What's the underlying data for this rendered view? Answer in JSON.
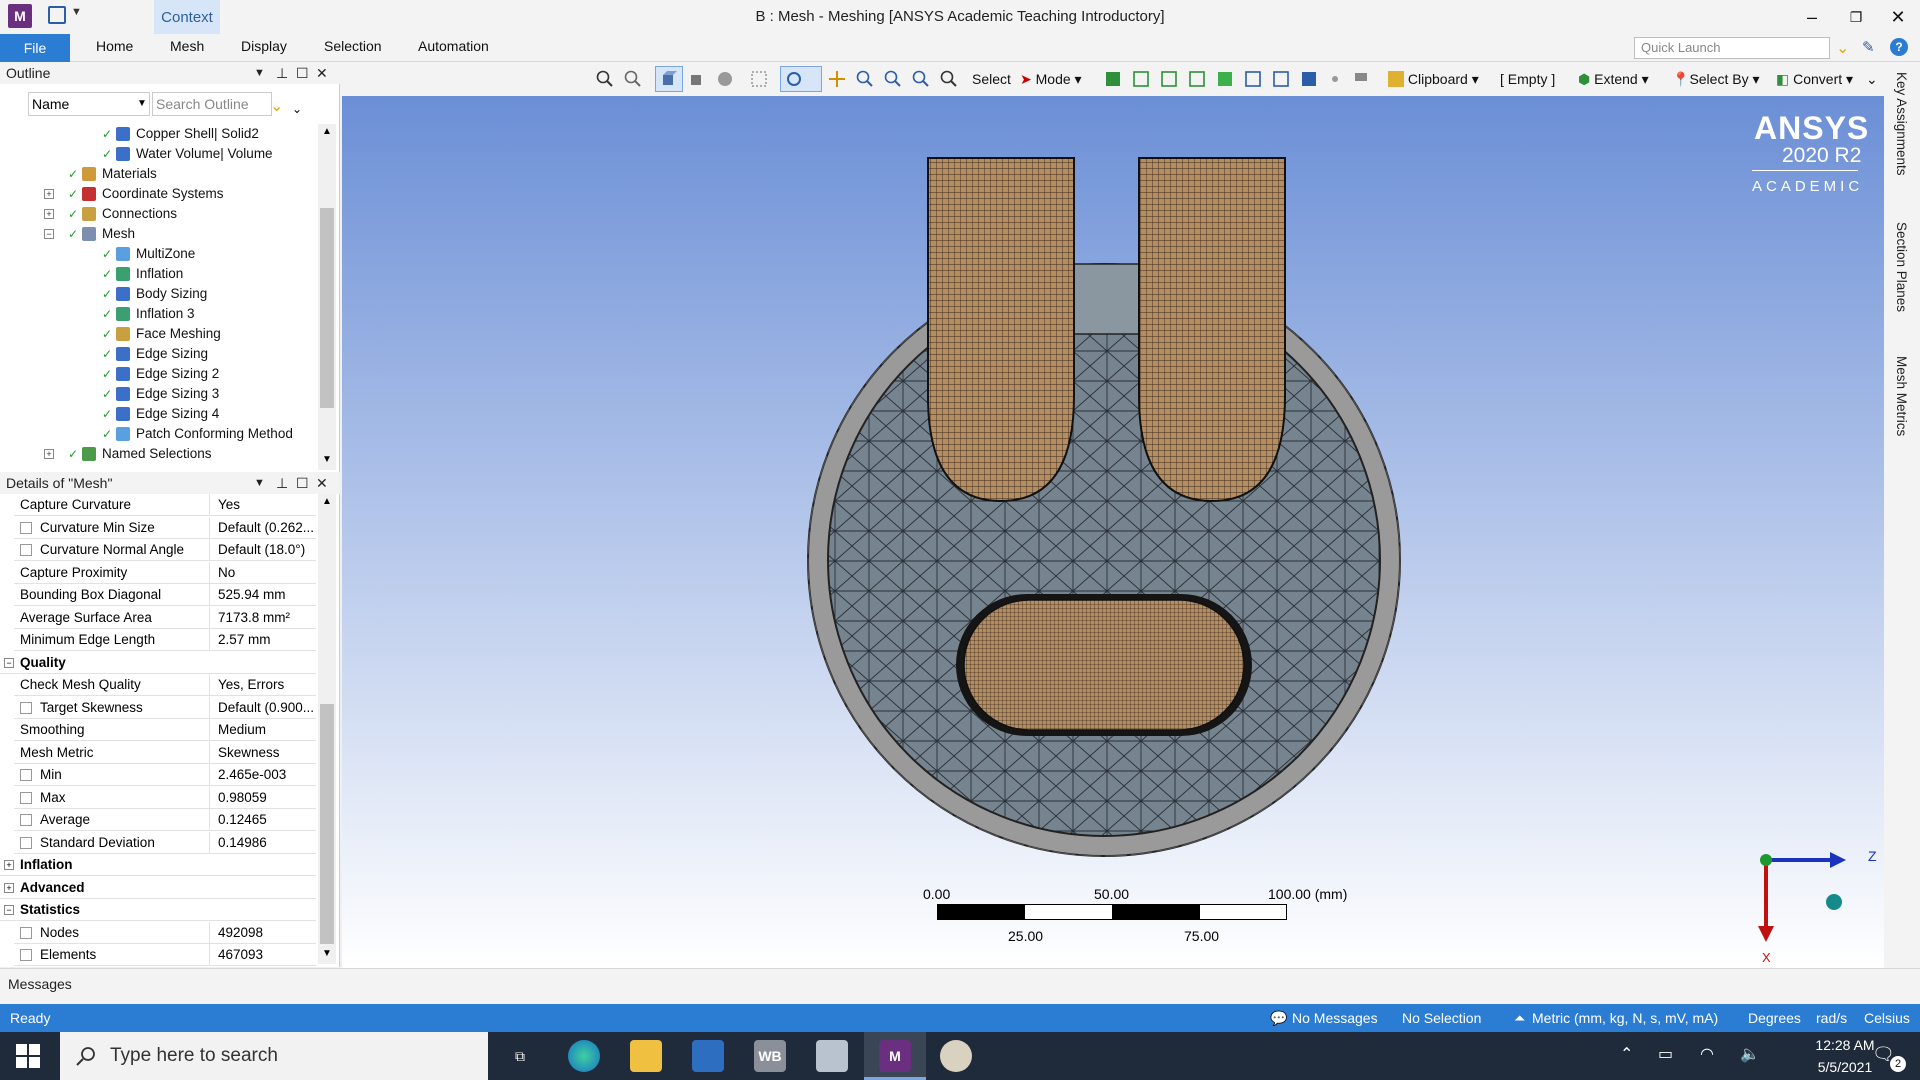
{
  "window": {
    "title": "B : Mesh - Meshing [ANSYS Academic Teaching Introductory]",
    "context_tab": "Context",
    "app_icon": "M"
  },
  "ribbon": {
    "tabs": [
      "File",
      "Home",
      "Mesh",
      "Display",
      "Selection",
      "Automation"
    ],
    "quick_launch_placeholder": "Quick Launch"
  },
  "toolbar": {
    "select_label": "Select",
    "mode_label": "Mode",
    "clipboard_label": "Clipboard",
    "empty_label": "[ Empty ]",
    "extend_label": "Extend",
    "select_by_label": "Select By",
    "convert_label": "Convert"
  },
  "outline": {
    "title": "Outline",
    "filter_value": "Name",
    "search_placeholder": "Search Outline",
    "items": [
      {
        "label": "Copper Shell|  Solid2",
        "icon": "solid-body-icon"
      },
      {
        "label": "Water Volume|  Volume",
        "icon": "solid-body-icon"
      },
      {
        "label": "Materials",
        "icon": "materials-icon"
      },
      {
        "label": "Coordinate Systems",
        "icon": "coordinate-systems-icon"
      },
      {
        "label": "Connections",
        "icon": "connections-icon"
      },
      {
        "label": "Mesh",
        "icon": "mesh-icon"
      },
      {
        "label": "MultiZone",
        "icon": "multizone-icon"
      },
      {
        "label": "Inflation",
        "icon": "inflation-icon"
      },
      {
        "label": "Body Sizing",
        "icon": "sizing-icon"
      },
      {
        "label": "Inflation 3",
        "icon": "inflation-icon"
      },
      {
        "label": "Face Meshing",
        "icon": "face-meshing-icon"
      },
      {
        "label": "Edge Sizing",
        "icon": "sizing-icon"
      },
      {
        "label": "Edge Sizing 2",
        "icon": "sizing-icon"
      },
      {
        "label": "Edge Sizing 3",
        "icon": "sizing-icon"
      },
      {
        "label": "Edge Sizing 4",
        "icon": "sizing-icon"
      },
      {
        "label": "Patch Conforming Method",
        "icon": "patch-conforming-icon"
      },
      {
        "label": "Named Selections",
        "icon": "named-selections-icon"
      }
    ]
  },
  "details": {
    "title": "Details of \"Mesh\"",
    "rows": [
      {
        "key": "Capture Curvature",
        "value": "Yes",
        "checkbox": false
      },
      {
        "key": "Curvature Min Size",
        "value": "Default (0.262...",
        "checkbox": true
      },
      {
        "key": "Curvature Normal Angle",
        "value": "Default (18.0°)",
        "checkbox": true
      },
      {
        "key": "Capture Proximity",
        "value": "No",
        "checkbox": false
      },
      {
        "key": "Bounding Box Diagonal",
        "value": "525.94 mm",
        "checkbox": false
      },
      {
        "key": "Average Surface Area",
        "value": "7173.8 mm²",
        "checkbox": false
      },
      {
        "key": "Minimum Edge Length",
        "value": "2.57 mm",
        "checkbox": false
      }
    ],
    "quality_group": "Quality",
    "quality_rows": [
      {
        "key": "Check Mesh Quality",
        "value": "Yes, Errors",
        "checkbox": false
      },
      {
        "key": "Target Skewness",
        "value": "Default (0.900...",
        "checkbox": true
      },
      {
        "key": "Smoothing",
        "value": "Medium",
        "checkbox": false
      },
      {
        "key": "Mesh Metric",
        "value": "Skewness",
        "checkbox": false
      },
      {
        "key": "Min",
        "value": "2.465e-003",
        "checkbox": true
      },
      {
        "key": "Max",
        "value": "0.98059",
        "checkbox": true
      },
      {
        "key": "Average",
        "value": "0.12465",
        "checkbox": true
      },
      {
        "key": "Standard Deviation",
        "value": "0.14986",
        "checkbox": true
      }
    ],
    "inflation_group": "Inflation",
    "advanced_group": "Advanced",
    "statistics_group": "Statistics",
    "statistics_rows": [
      {
        "key": "Nodes",
        "value": "492098",
        "checkbox": true
      },
      {
        "key": "Elements",
        "value": "467093",
        "checkbox": true
      }
    ]
  },
  "viewport": {
    "logo_line1": "ANSYS",
    "logo_line2": "2020 R2",
    "logo_line3": "ACADEMIC",
    "scale_labels_top": [
      "0.00",
      "50.00",
      "100.00 (mm)"
    ],
    "scale_labels_bottom": [
      "25.00",
      "75.00"
    ],
    "axis_z": "Z",
    "axis_x": "X"
  },
  "right_rail": [
    "Key Assignments",
    "Section Planes",
    "Mesh Metrics"
  ],
  "messages_label": "Messages",
  "status": {
    "ready": "Ready",
    "no_messages": "No Messages",
    "no_selection": "No Selection",
    "units": "Metric (mm, kg, N, s, mV, mA)",
    "angle": "Degrees",
    "rate": "rad/s",
    "temperature": "Celsius"
  },
  "taskbar": {
    "search_placeholder": "Type here to search",
    "time": "12:28 AM",
    "date": "5/5/2021",
    "notifications": "2",
    "apps": [
      "WB",
      "M"
    ]
  },
  "colors": {
    "accent": "#2b7cd3",
    "viewport_top": "#6b8fd6",
    "mesh_copper": "#b38b62",
    "mesh_gray": "#7e8a94"
  }
}
